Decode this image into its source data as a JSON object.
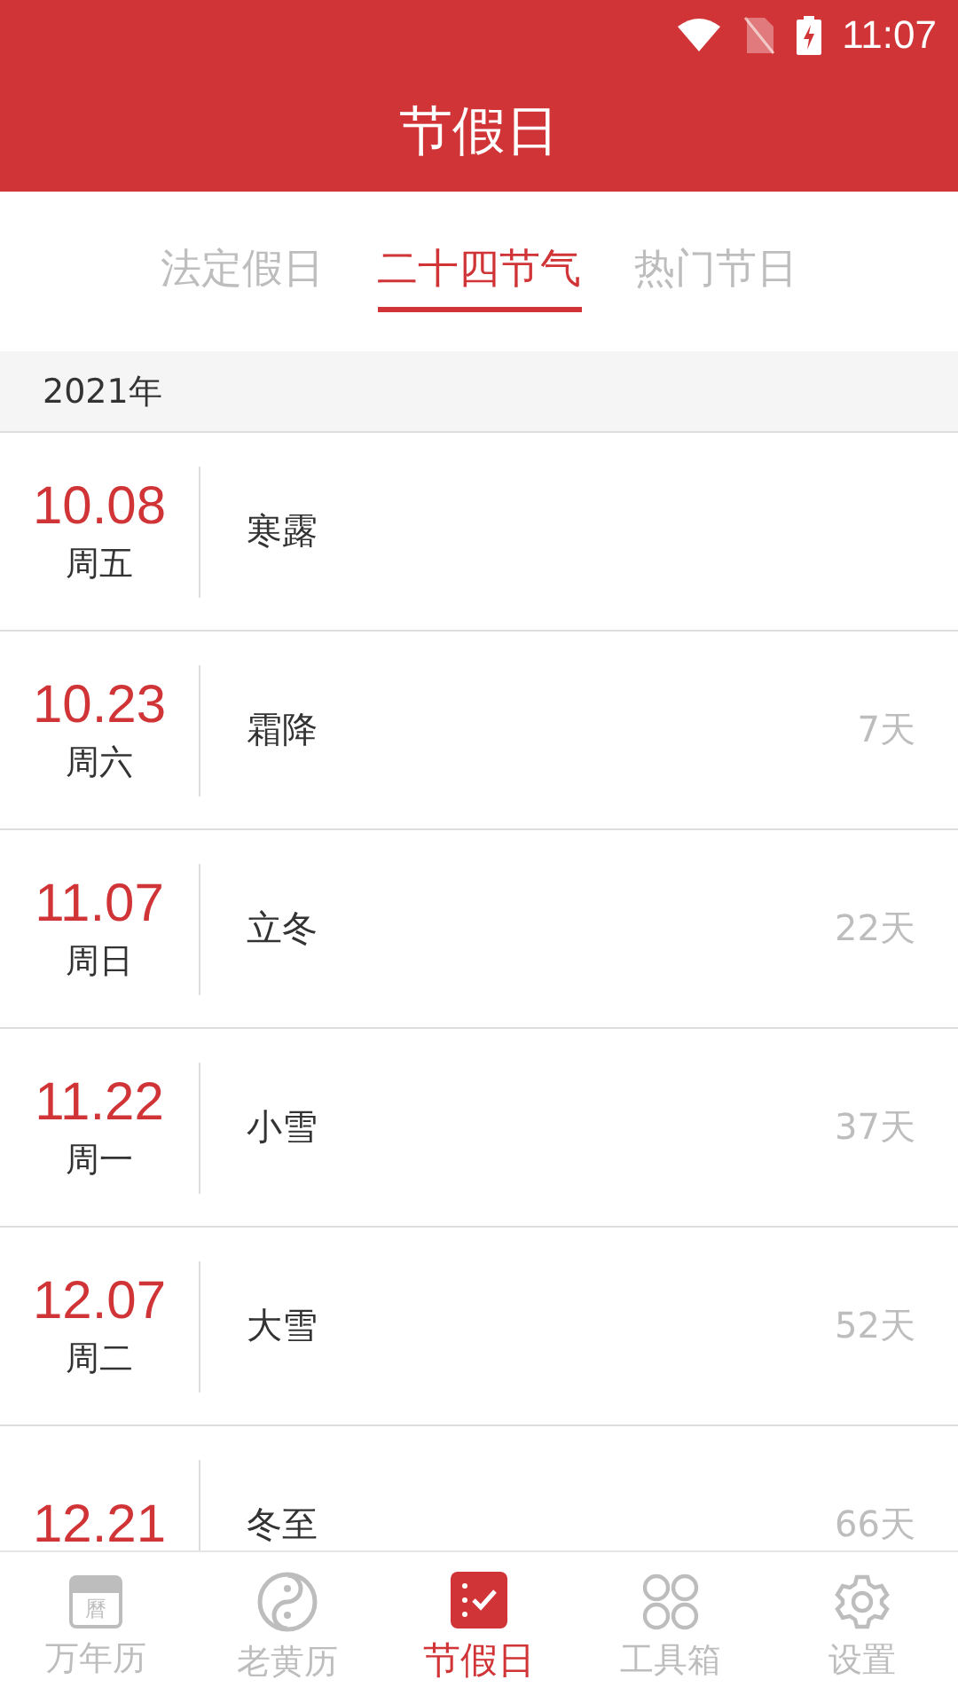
{
  "status_bar": {
    "time": "11:07"
  },
  "header": {
    "title": "节假日"
  },
  "tabs": [
    {
      "label": "法定假日",
      "selected": false
    },
    {
      "label": "二十四节气",
      "selected": true
    },
    {
      "label": "热门节日",
      "selected": false
    }
  ],
  "year": "2021年",
  "rows": [
    {
      "date": "10.08",
      "weekday": "周五",
      "name": "寒露"
    },
    {
      "date": "10.23",
      "weekday": "周六",
      "name": "霜降",
      "days": "7天"
    },
    {
      "date": "11.07",
      "weekday": "周日",
      "name": "立冬",
      "days": "22天"
    },
    {
      "date": "11.22",
      "weekday": "周一",
      "name": "小雪",
      "days": "37天"
    },
    {
      "date": "12.07",
      "weekday": "周二",
      "name": "大雪",
      "days": "52天"
    },
    {
      "date": "12.21",
      "name": "冬至",
      "days": "66天"
    }
  ],
  "nav": [
    {
      "kind": "calendar",
      "label": "万年历",
      "glyph": "曆",
      "selected": false
    },
    {
      "kind": "yinyang",
      "label": "老黄历",
      "selected": false
    },
    {
      "kind": "holiday",
      "label": "节假日",
      "selected": true
    },
    {
      "kind": "tools",
      "label": "工具箱",
      "selected": false
    },
    {
      "kind": "settings",
      "label": "设置",
      "selected": false
    }
  ]
}
